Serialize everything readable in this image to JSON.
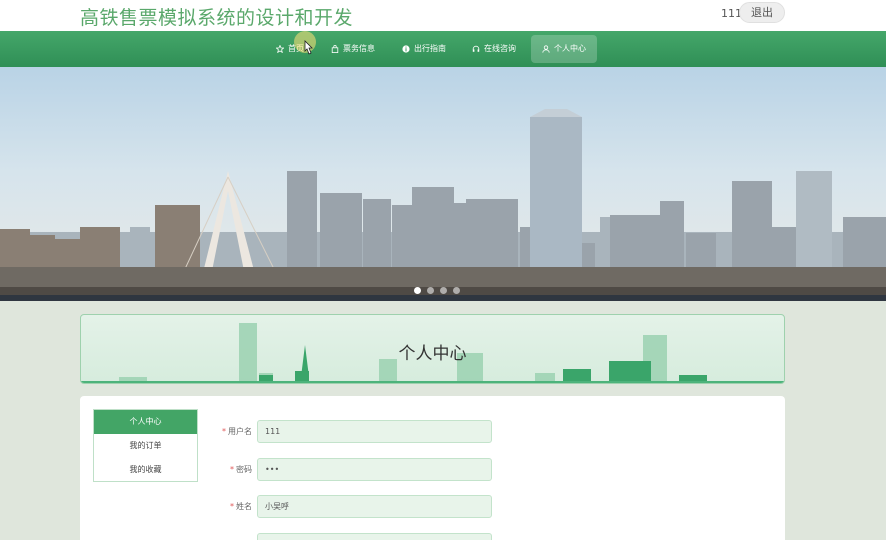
{
  "header": {
    "title": "高铁售票模拟系统的设计和开发",
    "username": "111",
    "logout_label": "退出"
  },
  "nav": {
    "items": [
      {
        "label": "首页",
        "icon": "star-icon"
      },
      {
        "label": "票务信息",
        "icon": "bag-icon"
      },
      {
        "label": "出行指南",
        "icon": "info-icon"
      },
      {
        "label": "在线咨询",
        "icon": "headset-icon"
      },
      {
        "label": "个人中心",
        "icon": "user-icon"
      }
    ],
    "active_index": 4
  },
  "carousel": {
    "slide_count": 4,
    "active_index": 0
  },
  "page": {
    "title": "个人中心"
  },
  "side_menu": {
    "items": [
      "个人中心",
      "我的订单",
      "我的收藏"
    ],
    "active_index": 0
  },
  "form": {
    "fields": [
      {
        "label": "用户名",
        "value": "111",
        "required": true
      },
      {
        "label": "密码",
        "value": "•••",
        "required": true
      },
      {
        "label": "姓名",
        "value": "小吴呼",
        "required": true
      },
      {
        "label": "",
        "value": "",
        "required": false
      }
    ]
  },
  "colors": {
    "primary": "#3a9b60",
    "title_green": "#5aa86b",
    "input_bg": "#e8f4ea"
  }
}
